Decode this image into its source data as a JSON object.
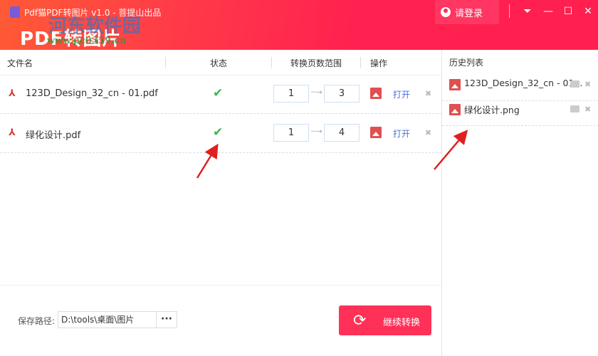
{
  "header": {
    "title": "Pdf猫PDF转图片 v1.0 - 菩提山出品",
    "app_name": "PDF转图片",
    "login_label": "请登录",
    "watermark": "河东软件园",
    "watermark_url": "www.pc0359.cn"
  },
  "columns": {
    "filename": "文件名",
    "status": "状态",
    "range": "转换页数范围",
    "action": "操作"
  },
  "files": [
    {
      "name": "123D_Design_32_cn - 01.pdf",
      "from": "1",
      "to": "3",
      "open": "打开"
    },
    {
      "name": "绿化设计.pdf",
      "from": "1",
      "to": "4",
      "open": "打开"
    }
  ],
  "history": {
    "title": "历史列表",
    "items": [
      {
        "name": "123D_Design_32_cn - 01..."
      },
      {
        "name": "绿化设计.png"
      }
    ]
  },
  "footer": {
    "path_label": "保存路径:",
    "path_value": "D:\\tools\\桌面\\图片",
    "browse": "···",
    "convert": "继续转换"
  },
  "colors": {
    "accent": "#ff3158",
    "link": "#4a6fd8",
    "ok": "#3bb54a"
  }
}
